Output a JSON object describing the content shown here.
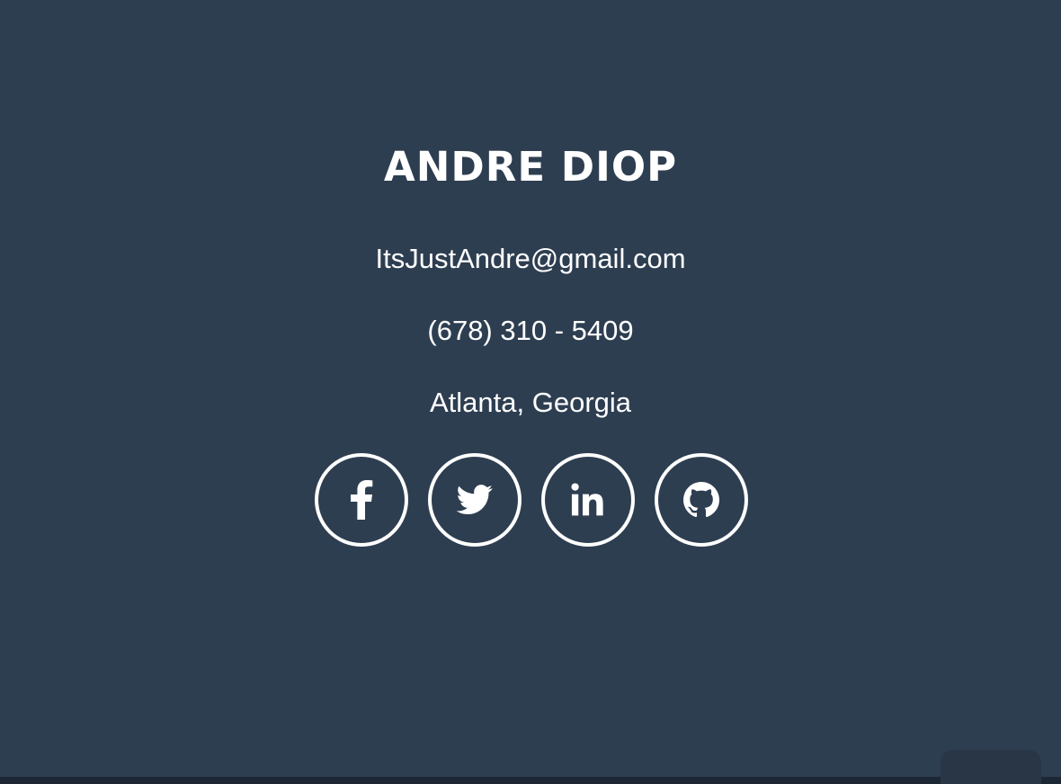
{
  "contact": {
    "name": "ANDRE DIOP",
    "email": "ItsJustAndre@gmail.com",
    "phone": "(678) 310 - 5409",
    "location": "Atlanta, Georgia"
  },
  "social": [
    {
      "icon": "facebook-icon"
    },
    {
      "icon": "twitter-icon"
    },
    {
      "icon": "linkedin-icon"
    },
    {
      "icon": "github-icon"
    }
  ],
  "colors": {
    "background": "#2e3e51",
    "text": "#ffffff",
    "footer_bar": "#1d2733",
    "corner_tab": "#283646"
  }
}
